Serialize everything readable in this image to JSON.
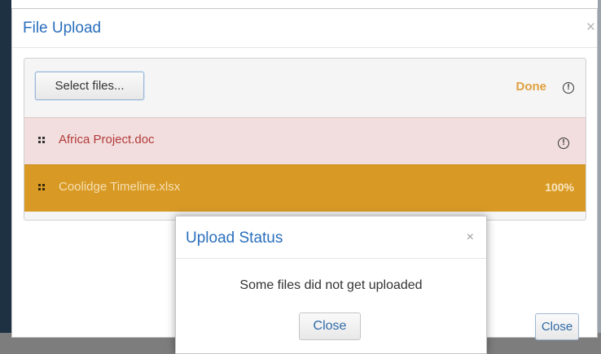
{
  "main_dialog": {
    "title": "File Upload",
    "close_symbol": "×",
    "close_button_label": "Close"
  },
  "toolbar": {
    "select_files_label": "Select files...",
    "status_text": "Done",
    "status_icon": "info-circle-icon"
  },
  "files": [
    {
      "name": "Africa Project.doc",
      "state": "failed",
      "indicator": "!",
      "indicator_icon": "info-circle-icon"
    },
    {
      "name": "Coolidge Timeline.xlsx",
      "state": "complete",
      "progress": "100%"
    }
  ],
  "status_dialog": {
    "title": "Upload Status",
    "close_symbol": "×",
    "message": "Some files did not get uploaded",
    "close_button_label": "Close"
  },
  "colors": {
    "title_blue": "#2a6fbd",
    "done_orange": "#e0a040",
    "failed_row_bg": "#f2dede",
    "complete_row_bg": "#d99a25"
  }
}
